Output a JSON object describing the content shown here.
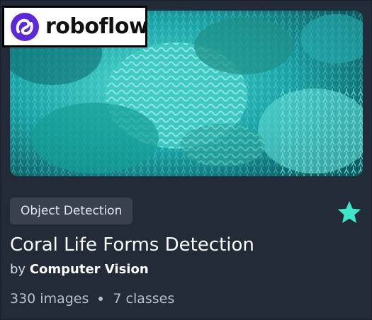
{
  "logo": {
    "text": "roboflow",
    "icon": "roboflow-logo-icon"
  },
  "card": {
    "project_type": "Object Detection",
    "title": "Coral Life Forms Detection",
    "by_prefix": "by",
    "author": "Computer Vision",
    "images_count": "330 images",
    "classes_count": "7 classes",
    "star_icon": "star-icon"
  },
  "colors": {
    "background": "#232a38",
    "badge_bg": "#3a404e",
    "star": "#3ee6c7",
    "logo_purple": "#5b2ad6"
  }
}
